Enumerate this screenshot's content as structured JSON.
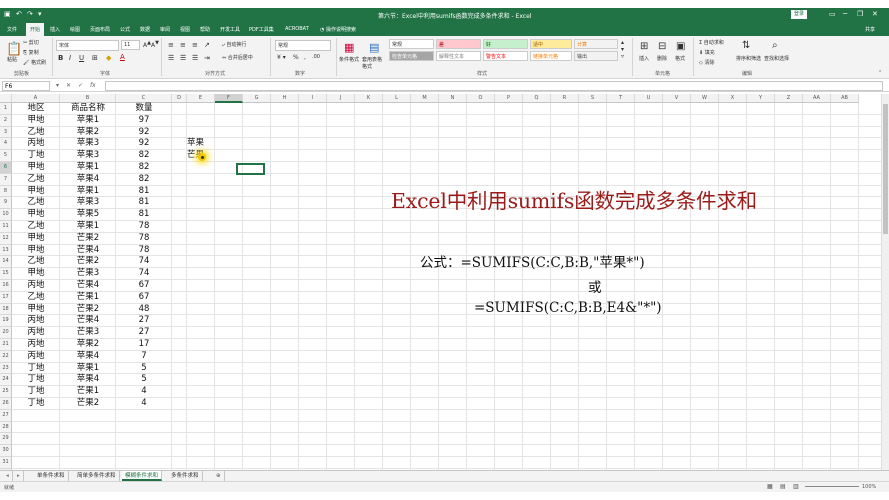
{
  "titlebar": {
    "title": "第六节：Excel中利用sumifs函数完成多条件求和 - Excel",
    "login": "登录",
    "qa_icons": [
      "save-icon",
      "undo-icon",
      "redo-icon",
      "customize-icon"
    ],
    "window_controls": [
      "ribbon-display-icon",
      "minimize-icon",
      "restore-icon",
      "close-icon"
    ]
  },
  "menu": {
    "items": [
      "文件",
      "开始",
      "插入",
      "绘图",
      "页面布局",
      "公式",
      "数据",
      "审阅",
      "视图",
      "帮助",
      "开发工具",
      "PDF工具集",
      "ACROBAT"
    ],
    "tell": "操作说明搜索",
    "share": "共享",
    "active": "开始"
  },
  "ribbon": {
    "clipboard": {
      "paste": "粘贴",
      "cut": "剪切",
      "copy": "复制",
      "format_painter": "格式刷",
      "group": "剪贴板"
    },
    "font": {
      "name": "宋体",
      "size": "11",
      "group": "字体",
      "bold": "B",
      "italic": "I",
      "underline": "U"
    },
    "alignment": {
      "wrap": "自动换行",
      "merge": "合并后居中",
      "group": "对齐方式"
    },
    "number": {
      "format": "常规",
      "group": "数字"
    },
    "styles": {
      "cond": "条件格式",
      "table": "套用表格格式",
      "cells": [
        {
          "label": "常规",
          "bg": "#ffffff",
          "color": "#333333"
        },
        {
          "label": "差",
          "bg": "#ffc7ce",
          "color": "#9c0006"
        },
        {
          "label": "好",
          "bg": "#c6efce",
          "color": "#006100"
        },
        {
          "label": "适中",
          "bg": "#ffeb9c",
          "color": "#9c5700"
        },
        {
          "label": "计算",
          "bg": "#f2f2f2",
          "color": "#fa7d00"
        },
        {
          "label": "检查单元格",
          "bg": "#a5a5a5",
          "color": "#ffffff"
        },
        {
          "label": "解释性文本",
          "bg": "#ffffff",
          "color": "#7f7f7f"
        },
        {
          "label": "警告文本",
          "bg": "#ffffff",
          "color": "#ff0000"
        },
        {
          "label": "链接单元格",
          "bg": "#ffffff",
          "color": "#fa7d00"
        },
        {
          "label": "输出",
          "bg": "#f2f2f2",
          "color": "#3f3f3f"
        }
      ],
      "group": "样式"
    },
    "cells_group": {
      "insert": "插入",
      "delete": "删除",
      "format": "格式",
      "group": "单元格"
    },
    "editing": {
      "autosum": "自动求和",
      "fill": "填充",
      "clear": "清除",
      "sort": "排序和筛选",
      "find": "查找和选择",
      "group": "编辑"
    }
  },
  "formula_bar": {
    "name_box": "F6",
    "formula": ""
  },
  "columns": [
    "A",
    "B",
    "C",
    "D",
    "E",
    "F",
    "G",
    "H",
    "I",
    "J",
    "K",
    "L",
    "M",
    "N",
    "O",
    "P",
    "Q",
    "R",
    "S",
    "T",
    "U",
    "V",
    "W",
    "X",
    "Y",
    "Z",
    "AA",
    "AB"
  ],
  "rows": [
    "1",
    "2",
    "3",
    "4",
    "5",
    "6",
    "7",
    "8",
    "9",
    "10",
    "11",
    "12",
    "13",
    "14",
    "15",
    "16",
    "17",
    "18",
    "19",
    "20",
    "21",
    "22",
    "23",
    "24",
    "25",
    "26",
    "27",
    "28",
    "29",
    "30",
    "31",
    "32",
    "33"
  ],
  "header": {
    "a": "地区",
    "b": "商品名称",
    "c": "数量"
  },
  "data": [
    [
      "甲地",
      "苹果1",
      "97"
    ],
    [
      "乙地",
      "苹果2",
      "92"
    ],
    [
      "丙地",
      "苹果3",
      "92"
    ],
    [
      "丁地",
      "苹果3",
      "82"
    ],
    [
      "甲地",
      "苹果1",
      "82"
    ],
    [
      "乙地",
      "苹果4",
      "82"
    ],
    [
      "甲地",
      "苹果1",
      "81"
    ],
    [
      "乙地",
      "苹果3",
      "81"
    ],
    [
      "甲地",
      "苹果5",
      "81"
    ],
    [
      "乙地",
      "苹果1",
      "78"
    ],
    [
      "甲地",
      "芒果2",
      "78"
    ],
    [
      "甲地",
      "芒果4",
      "78"
    ],
    [
      "乙地",
      "芒果2",
      "74"
    ],
    [
      "甲地",
      "芒果3",
      "74"
    ],
    [
      "丙地",
      "芒果4",
      "67"
    ],
    [
      "乙地",
      "芒果1",
      "67"
    ],
    [
      "甲地",
      "芒果2",
      "48"
    ],
    [
      "丙地",
      "芒果4",
      "27"
    ],
    [
      "丙地",
      "芒果3",
      "27"
    ],
    [
      "丙地",
      "苹果2",
      "17"
    ],
    [
      "丙地",
      "苹果4",
      "7"
    ],
    [
      "丁地",
      "苹果1",
      "5"
    ],
    [
      "丁地",
      "苹果4",
      "5"
    ],
    [
      "丁地",
      "芒果1",
      "4"
    ],
    [
      "丁地",
      "芒果2",
      "4"
    ]
  ],
  "criteria": {
    "e4": "苹果",
    "e5": "芒果"
  },
  "overlay": {
    "title": "Excel中利用sumifs函数完成多条件求和",
    "formula1": "公式：=SUMIFS(C:C,B:B,\"苹果*\")",
    "or": "或",
    "formula2": "=SUMIFS(C:C,B:B,E4&\"*\")"
  },
  "tabs": [
    "单条件求和",
    "简单多条件求和",
    "模糊条件求和",
    "多条件求和"
  ],
  "active_tab": "模糊条件求和",
  "status": {
    "ready": "就绪",
    "zoom": "100%"
  }
}
